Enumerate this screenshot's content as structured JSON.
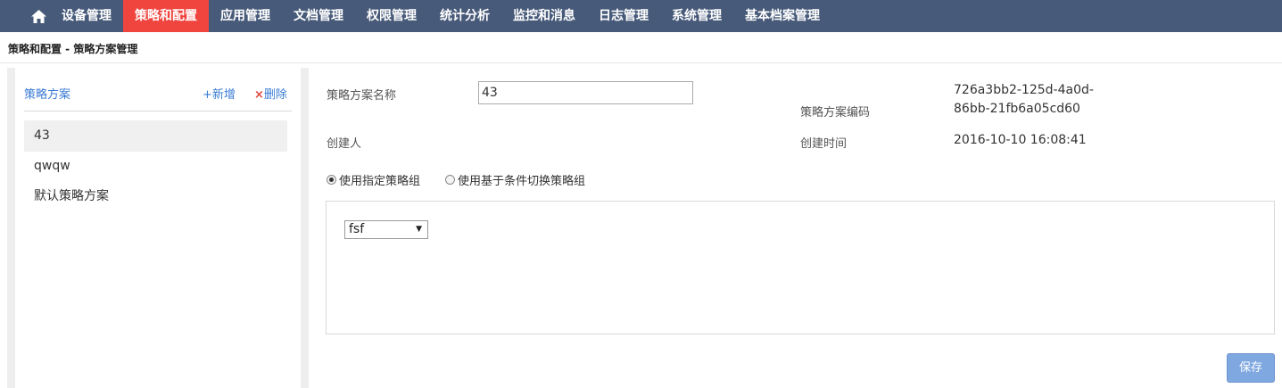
{
  "nav": {
    "home_icon": "home-icon",
    "items": [
      "设备管理",
      "策略和配置",
      "应用管理",
      "文档管理",
      "权限管理",
      "统计分析",
      "监控和消息",
      "日志管理",
      "系统管理",
      "基本档案管理"
    ],
    "active_index": 1,
    "colors": {
      "bar": "#475a79",
      "active": "#f0453f"
    }
  },
  "breadcrumb": "策略和配置 -  策略方案管理",
  "left_panel": {
    "title": "策略方案",
    "add_label": "新增",
    "delete_label": "删除",
    "items": [
      "43",
      "qwqw",
      "默认策略方案"
    ],
    "selected_index": 0
  },
  "form": {
    "name_label": "策略方案名称",
    "name_value": "43",
    "code_label": "策略方案编码",
    "code_value_line1": "726a3bb2-125d-4a0d-",
    "code_value_line2": "86bb-21fb6a05cd60",
    "creator_label": "创建人",
    "created_time_label": "创建时间",
    "created_time_value": "2016-10-10 16:08:41",
    "radio_option_1": "使用指定策略组",
    "radio_option_2": "使用基于条件切换策略组",
    "radio_selected": 1,
    "policy_group_selected": "fsf",
    "save_label": "保存"
  }
}
